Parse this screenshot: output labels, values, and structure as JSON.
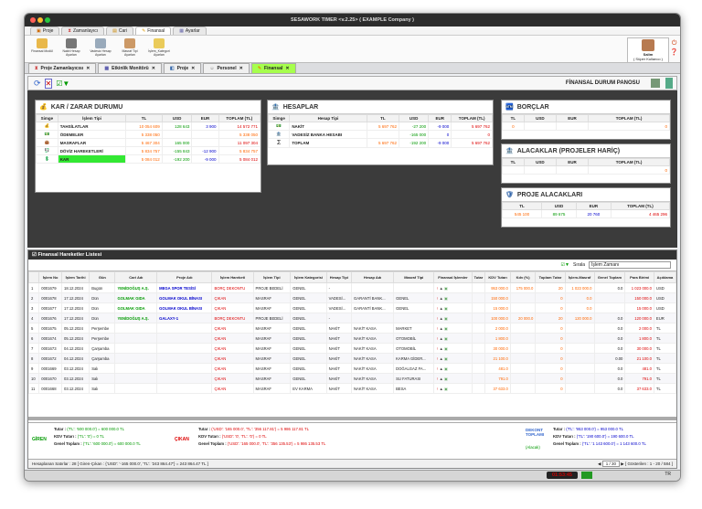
{
  "title": "SESAWORK TIMER <v.2.25> ( EXAMPLE Company )",
  "menu_tabs": [
    "Proje",
    "Zamanlayıcı",
    "Cari",
    "Finansal",
    "Ayarlar"
  ],
  "ribbon": [
    "Finansal Modül",
    "Nakit Hesap Ayarları",
    "Vadesiz Hesap Ayarları",
    "Masraf Tipi Ayarları",
    "İşlem_Kategori Ayarları"
  ],
  "user": {
    "name": "Salim",
    "role": "( Süper Kullanıcı )"
  },
  "doc_tabs": [
    "Proje Zamanlayıcısı",
    "Etkinlik Monitörü",
    "Proje",
    "Personel",
    "Finansal"
  ],
  "dashboard_title": "FİNANSAL DURUM PANOSU",
  "kar": {
    "title": "KAR / ZARAR DURUMU",
    "headers": [
      "Simge",
      "İşlem Tipi",
      "TL",
      "USD",
      "EUR",
      "TOPLAM (TL)"
    ],
    "rows": [
      [
        "TAHSİLATLAR",
        "10 054 609",
        "128 643",
        "3 900",
        "14 572 771"
      ],
      [
        "ÖDEMELER",
        "5 338 050",
        "",
        "",
        "5 338 050"
      ],
      [
        "MASRAFLAR",
        "5 467 304",
        "165 000",
        "",
        "11 097 304"
      ],
      [
        "DÖVİZ HAREKETLERİ",
        "5 834 757",
        "-155 843",
        "-12 900",
        "5 834 757"
      ],
      [
        "KAR",
        "5 084 012",
        "-192 200",
        "-9 000",
        "5 084 012"
      ]
    ]
  },
  "hesap": {
    "title": "HESAPLAR",
    "headers": [
      "Simge",
      "Hesap Tipi",
      "TL",
      "USD",
      "EUR",
      "TOPLAM (TL)"
    ],
    "rows": [
      [
        "NAKİT",
        "5 697 762",
        "-27 200",
        "-9 000",
        "5 697 762"
      ],
      [
        "VADESİZ BANKA HESABI",
        "",
        "-165 000",
        "0",
        "0"
      ],
      [
        "TOPLAM",
        "5 697 762",
        "-192 200",
        "-9 000",
        "5 697 762"
      ]
    ]
  },
  "borc": {
    "title": "BORÇLAR",
    "headers": [
      "TL",
      "USD",
      "EUR",
      "TOPLAM (TL)"
    ],
    "row": [
      "0",
      "",
      "",
      "0"
    ]
  },
  "alacak": {
    "title": "ALACAKLAR (PROJELER HARİÇ)",
    "headers": [
      "TL",
      "USD",
      "EUR",
      "TOPLAM (TL)"
    ],
    "row": [
      "",
      "",
      "",
      "0"
    ]
  },
  "proje": {
    "title": "PROJE ALACAKLARI",
    "headers": [
      "TL",
      "USD",
      "EUR",
      "TOPLAM (TL)"
    ],
    "row": [
      "545 100",
      "89 675",
      "20 760",
      "4 465 296"
    ]
  },
  "list_title": "Finansal Hareketler Listesi",
  "filter": {
    "sort_label": "Sırala",
    "sort_value": "İşlem Zamanı"
  },
  "grid_headers": [
    "",
    "İşlem No",
    "İşlem Tarihi",
    "Gün",
    "Cari Adı",
    "Proje Adı",
    "İşlem Hareketi",
    "İşlem Tipi",
    "İşlem Kategorisi",
    "Hesap Tipi",
    "Hesap Adı",
    "Masraf Tipi",
    "Finansal İşlemler",
    "Tutar",
    "KDV Tutarı",
    "Kdv (%)",
    "Toplam Tutar",
    "İşlem-Masraf",
    "Genel Toplam",
    "Para Birimi",
    "Açıklama"
  ],
  "grid_rows": [
    [
      "1",
      "0001679",
      "18.12.2024",
      "Bugün",
      "YENİDOĞUŞ A.Ş.",
      "MEGA SPOR TESİSİ",
      "BORÇ DEKONTU",
      "PROJE BEDELİ",
      "GENEL",
      "-",
      "",
      "",
      "",
      "",
      "953 000.0",
      "175 000.0",
      "20",
      "1 023 000.0",
      "0.0",
      "1 023 000.0",
      "USD"
    ],
    [
      "2",
      "0001678",
      "17.12.2024",
      "Dün",
      "GOLMAK GIDA",
      "GOLMAK OKUL BİNASI",
      "ÇIKAN",
      "MASRAF",
      "GENEL",
      "VADESİ...",
      "GARANTİ BANK...",
      "GENEL",
      "",
      "",
      "150 000.0",
      "",
      "0",
      "0.0",
      "",
      "150 000.0",
      "USD"
    ],
    [
      "3",
      "0001677",
      "17.12.2024",
      "Dün",
      "GOLMAK GIDA",
      "GOLMAK OKUL BİNASI",
      "ÇIKAN",
      "MASRAF",
      "GENEL",
      "VADESİ...",
      "GARANTİ BANK...",
      "GENEL",
      "",
      "",
      "15 000.0",
      "",
      "0",
      "0.0",
      "",
      "15 000.0",
      "USD"
    ],
    [
      "4",
      "0001676",
      "17.12.2024",
      "Dün",
      "YENİDOĞUŞ A.Ş.",
      "GALAXY-1",
      "BORÇ DEKONTU",
      "PROJE BEDELİ",
      "GENEL",
      "-",
      "",
      "",
      "",
      "",
      "100 000.0",
      "20 000.0",
      "20",
      "120 000.0",
      "0.0",
      "120 000.0",
      "EUR"
    ],
    [
      "5",
      "0001675",
      "05.12.2024",
      "Perşembe",
      "",
      "",
      "ÇIKAN",
      "MASRAF",
      "GENEL",
      "NAKİT",
      "NAKİT KASA",
      "MARKET",
      "",
      "",
      "2 000.0",
      "",
      "0",
      "",
      "0.0",
      "2 000.0",
      "TL"
    ],
    [
      "6",
      "0001674",
      "05.12.2024",
      "Perşembe",
      "",
      "",
      "ÇIKAN",
      "MASRAF",
      "GENEL",
      "NAKİT",
      "NAKİT KASA",
      "OTOMOBİL",
      "",
      "",
      "1 800.0",
      "",
      "0",
      "",
      "0.0",
      "1 800.0",
      "TL"
    ],
    [
      "7",
      "0001673",
      "04.12.2024",
      "Çarşamba",
      "",
      "",
      "ÇIKAN",
      "MASRAF",
      "GENEL",
      "NAKİT",
      "NAKİT KASA",
      "OTOMOBİL",
      "",
      "",
      "30 000.0",
      "",
      "0",
      "",
      "0.0",
      "30 000.0",
      "TL"
    ],
    [
      "8",
      "0001672",
      "04.12.2024",
      "Çarşamba",
      "",
      "",
      "ÇIKAN",
      "MASRAF",
      "GENEL",
      "NAKİT",
      "NAKİT KASA",
      "KARMA GİDER...",
      "",
      "",
      "21 100.0",
      "",
      "0",
      "",
      "0.00",
      "21 100.0",
      "TL"
    ],
    [
      "9",
      "0001669",
      "03.12.2024",
      "Salı",
      "",
      "",
      "ÇIKAN",
      "MASRAF",
      "GENEL",
      "NAKİT",
      "NAKİT KASA",
      "DOĞALGAZ FA...",
      "",
      "",
      "481.0",
      "",
      "0",
      "",
      "0.0",
      "481.0",
      "TL"
    ],
    [
      "10",
      "0001670",
      "03.12.2024",
      "Salı",
      "",
      "",
      "ÇIKAN",
      "MASRAF",
      "GENEL",
      "NAKİT",
      "NAKİT KASA",
      "SU FATURASI",
      "",
      "",
      "791.0",
      "",
      "0",
      "",
      "0.0",
      "791.0",
      "TL"
    ],
    [
      "11",
      "0001668",
      "03.12.2024",
      "Salı",
      "",
      "",
      "ÇIKAN",
      "MASRAF",
      "EV KARMA",
      "NAKİT",
      "NAKİT KASA",
      "BESA",
      "",
      "",
      "37 633.0",
      "",
      "0",
      "",
      "0.0",
      "37 633.0",
      "TL"
    ]
  ],
  "footer": {
    "giren_label": "GİREN",
    "cikan_label": "ÇIKAN",
    "dekont_label": "DEKONT TOPLAMI",
    "alacak_label": "(Alacak)",
    "tutar": "Tutar :",
    "kdv": "KDV Tutarı :",
    "genel": "Genel Toplam :",
    "giren": [
      "('TL': '600 000.0') = 600 000.0 TL",
      "('TL': '0') = 0 TL",
      "('TL': '600 000.0') = 600 000.0 TL"
    ],
    "cikan": [
      "('USD': '165 000.0', 'TL': '356 117.81') = 5 986 117.81 TL",
      "('USD': '0', 'TL': '0') = 0 TL",
      "('USD': '165 000.0', 'TL': '356 135.53') = 5 986 135.53 TL"
    ],
    "dekont": [
      "('TL': '953 000.0') = 953 000.0 TL",
      "('TL': '190 600.0') = 190 600.0 TL",
      "('TL': '1 143 600.0') = 1 143 600.0 TL"
    ]
  },
  "status": "Hesaplanan Satırlar : 28   [ Giren-Çıkan : {'USD': '-165 000.0', 'TL': '243 864.47'} = 243 864.47 TL ]",
  "pager": "1 / 30",
  "page_info": "[ Gösterilen : 1 - 20 / 584 ]",
  "clock": "01:53:45",
  "lang": "TR"
}
